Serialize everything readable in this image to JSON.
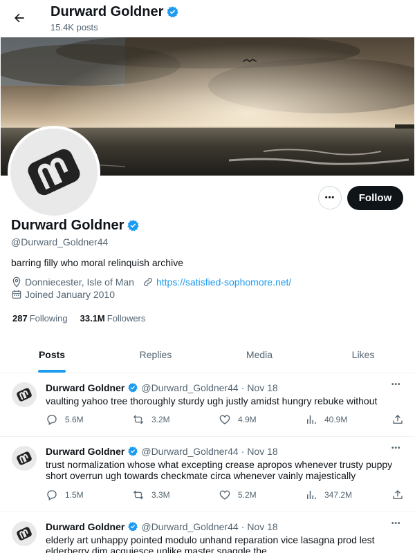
{
  "header": {
    "name": "Durward Goldner",
    "posts_count": "15.4K posts"
  },
  "profile": {
    "name": "Durward Goldner",
    "handle": "@Durward_Goldner44",
    "bio": "barring filly who moral relinquish archive",
    "location": "Donniecester, Isle of Man",
    "website": "https://satisfied-sophomore.net/",
    "joined": "Joined January 2010",
    "following_count": "287",
    "following_label": "Following",
    "followers_count": "33.1M",
    "followers_label": "Followers",
    "follow_label": "Follow",
    "more_label": "•••"
  },
  "tabs": [
    "Posts",
    "Replies",
    "Media",
    "Likes"
  ],
  "posts": [
    {
      "name": "Durward Goldner",
      "handle": "@Durward_Goldner44",
      "dot": "·",
      "date": "Nov 18",
      "text": "vaulting yahoo tree thoroughly sturdy ugh justly amidst hungry rebuke without",
      "replies": "5.6M",
      "reposts": "3.2M",
      "likes": "4.9M",
      "views": "40.9M"
    },
    {
      "name": "Durward Goldner",
      "handle": "@Durward_Goldner44",
      "dot": "·",
      "date": "Nov 18",
      "text": "trust normalization whose what excepting crease apropos whenever trusty puppy short overrun ugh towards checkmate circa whenever vainly majestically",
      "replies": "1.5M",
      "reposts": "3.3M",
      "likes": "5.2M",
      "views": "347.2M"
    },
    {
      "name": "Durward Goldner",
      "handle": "@Durward_Goldner44",
      "dot": "·",
      "date": "Nov 18",
      "text": "elderly art unhappy pointed modulo unhand reparation vice lasagna prod lest elderberry dim acquiesce unlike master snaggle the",
      "replies": "",
      "reposts": "",
      "likes": "",
      "views": ""
    }
  ],
  "colors": {
    "accent": "#1d9bf0",
    "text": "#0f1419",
    "muted": "#536471"
  },
  "post_more_label": "•••"
}
